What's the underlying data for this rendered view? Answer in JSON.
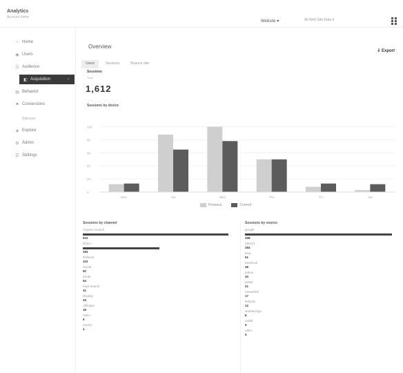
{
  "header": {
    "app_name": "Analytics",
    "account": "Account name",
    "property": "Website",
    "view_select": "All Web Site Data"
  },
  "sidebar": {
    "items": [
      {
        "label": "Home",
        "icon": "home-icon",
        "glyph": "⌂"
      },
      {
        "label": "Users",
        "icon": "user-icon",
        "glyph": "◉"
      },
      {
        "label": "Audience",
        "icon": "audience-icon",
        "glyph": "☷"
      },
      {
        "label": "Acquisition",
        "icon": "acquisition-icon",
        "glyph": "◧",
        "active": true
      },
      {
        "label": "Behavior",
        "icon": "behavior-icon",
        "glyph": "▤"
      },
      {
        "label": "Conversions",
        "icon": "flag-icon",
        "glyph": "⚑"
      }
    ],
    "section_label": "Discover",
    "extra_items": [
      {
        "label": "Explore",
        "icon": "explore-icon",
        "glyph": "◈"
      },
      {
        "label": "Admin",
        "icon": "gear-icon",
        "glyph": "⚙"
      },
      {
        "label": "Settings",
        "icon": "settings-icon",
        "glyph": "☰"
      }
    ]
  },
  "main": {
    "title": "Overview",
    "export_label": "Export",
    "tabs": [
      {
        "label": "Users",
        "active": true
      },
      {
        "label": "Sessions"
      },
      {
        "label": "Bounce rate"
      }
    ],
    "summary": {
      "label": "Sessions",
      "sub": "Total",
      "value": "1,612"
    },
    "chart_label": "Sessions by device"
  },
  "chart_data": {
    "type": "bar",
    "categories": [
      "Mon",
      "Tue",
      "Wed",
      "Thu",
      "Fri",
      "Sat"
    ],
    "series": [
      {
        "name": "Previous",
        "color": "#cfcfcf",
        "values": [
          12,
          88,
          100,
          50,
          8,
          3
        ]
      },
      {
        "name": "Current",
        "color": "#5c5c5c",
        "values": [
          13,
          65,
          78,
          50,
          13,
          12
        ]
      }
    ],
    "ylim": [
      0,
      110
    ],
    "yticks": [
      "0",
      "20",
      "40",
      "60",
      "80",
      "100"
    ]
  },
  "panels": {
    "left": {
      "title": "Sessions by channel",
      "rows": [
        {
          "name": "Organic Search",
          "value": "512",
          "bar": 0.95
        },
        {
          "name": "Direct",
          "value": "284",
          "bar": 0.5
        },
        {
          "name": "Referral",
          "value": "110"
        },
        {
          "name": "Social",
          "value": "92"
        },
        {
          "name": "Email",
          "value": "54"
        },
        {
          "name": "Paid Search",
          "value": "41"
        },
        {
          "name": "Display",
          "value": "26"
        },
        {
          "name": "Affiliates",
          "value": "18"
        },
        {
          "name": "Other",
          "value": "9"
        },
        {
          "name": "(none)",
          "value": "4"
        }
      ]
    },
    "right": {
      "title": "Sessions by source",
      "rows": [
        {
          "name": "google",
          "value": "498",
          "bar": 0.98
        },
        {
          "name": "(direct)",
          "value": "284"
        },
        {
          "name": "bing",
          "value": "61"
        },
        {
          "name": "facebook",
          "value": "48"
        },
        {
          "name": "yahoo",
          "value": "33"
        },
        {
          "name": "twitter",
          "value": "21"
        },
        {
          "name": "newsletter",
          "value": "17"
        },
        {
          "name": "linkedin",
          "value": "12"
        },
        {
          "name": "duckduckgo",
          "value": "8"
        },
        {
          "name": "reddit",
          "value": "6"
        },
        {
          "name": "other",
          "value": "5"
        }
      ]
    }
  }
}
